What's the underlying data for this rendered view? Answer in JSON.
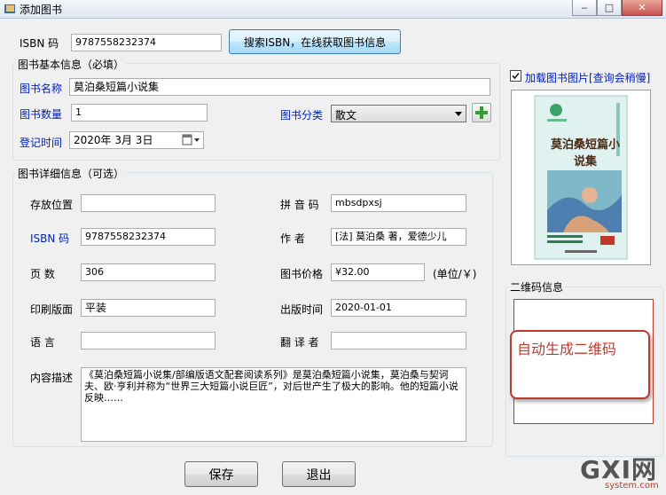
{
  "window": {
    "title": "添加图书"
  },
  "isbn_top": {
    "label": "ISBN  码",
    "value": "9787558232374",
    "search_button": "搜索ISBN，在线获取图书信息"
  },
  "basic": {
    "group_title": "图书基本信息（必填）",
    "name_label": "图书名称",
    "name_value": "莫泊桑短篇小说集",
    "qty_label": "图书数量",
    "qty_value": "1",
    "category_label": "图书分类",
    "category_value": "散文",
    "date_label": "登记时间",
    "date_value": "2020年 3月 3日"
  },
  "detail": {
    "group_title": "图书详细信息（可选）",
    "location_label": "存放位置",
    "location_value": "",
    "pinyin_label": "拼 音 码",
    "pinyin_value": "mbsdpxsj",
    "isbn_label": "ISBN  码",
    "isbn_value": "9787558232374",
    "author_label": "作    者",
    "author_value": "[法] 莫泊桑 著，爱德少儿",
    "pages_label": "页    数",
    "pages_value": "306",
    "price_label": "图书价格",
    "price_value": "¥32.00",
    "price_unit": "(单位/￥)",
    "binding_label": "印刷版面",
    "binding_value": "平装",
    "pubdate_label": "出版时间",
    "pubdate_value": "2020-01-01",
    "language_label": "语    言",
    "language_value": "",
    "translator_label": "翻 译 者",
    "translator_value": "",
    "desc_label": "内容描述",
    "desc_value": "《莫泊桑短篇小说集/部编版语文配套阅读系列》是莫泊桑短篇小说集，莫泊桑与契诃夫、欧·亨利并称为“世界三大短篇小说巨匠”，对后世产生了极大的影响。他的短篇小说反映……"
  },
  "cover": {
    "checkbox_label": "加载图书图片[查询会稍慢]",
    "checked": true,
    "book_title": "莫泊桑短篇小说集"
  },
  "qr": {
    "group_title": "二维码信息",
    "placeholder": "自动生成二维码"
  },
  "footer": {
    "save": "保存",
    "exit": "退出"
  },
  "watermark": {
    "text": "GXI网",
    "sub": "system.com"
  },
  "colors": {
    "accent_red": "#c0392b",
    "label_blue": "#0020c0",
    "add_green": "#2e9e2e"
  }
}
